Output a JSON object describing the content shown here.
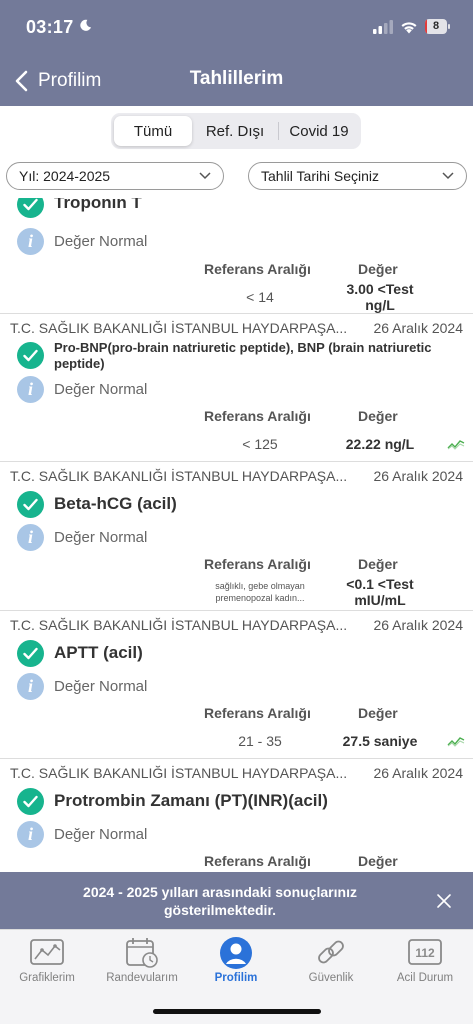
{
  "status_bar": {
    "time": "03:17",
    "battery_level": "8",
    "battery_fraction": 0.08
  },
  "nav": {
    "back_label": "Profilim",
    "title": "Tahlillerim"
  },
  "segments": [
    "Tümü",
    "Ref. Dışı",
    "Covid 19"
  ],
  "filters": {
    "year": "Yıl: 2024-2025",
    "date": "Tahlil Tarihi Seçiniz"
  },
  "results": {
    "ref_header": "Referans Aralığı",
    "value_header": "Değer",
    "status_label": "Değer Normal",
    "items": [
      {
        "hospital": "",
        "date": "",
        "name": "Troponin T",
        "reference": "< 14",
        "value": "3.00 <Test ng/L",
        "trend": false
      },
      {
        "hospital": "T.C. SAĞLIK BAKANLIĞI İSTANBUL HAYDARPAŞA...",
        "date": "26 Aralık 2024",
        "name": "Pro-BNP(pro-brain natriuretic peptide), BNP (brain natriuretic peptide)",
        "reference": "< 125",
        "value": "22.22 ng/L",
        "trend": true
      },
      {
        "hospital": "T.C. SAĞLIK BAKANLIĞI İSTANBUL HAYDARPAŞA...",
        "date": "26 Aralık 2024",
        "name": "Beta-hCG (acil)",
        "reference": "sağlıklı, gebe olmayan premenopozal kadın...",
        "value": "<0.1 <Test mIU/mL",
        "trend": false
      },
      {
        "hospital": "T.C. SAĞLIK BAKANLIĞI İSTANBUL HAYDARPAŞA...",
        "date": "26 Aralık 2024",
        "name": "APTT (acil)",
        "reference": "21 - 35",
        "value": "27.5 saniye",
        "trend": true
      },
      {
        "hospital": "T.C. SAĞLIK BAKANLIĞI İSTANBUL HAYDARPAŞA...",
        "date": "26 Aralık 2024",
        "name": "Protrombin Zamanı (PT)(INR)(acil)",
        "reference": "",
        "value": "",
        "trend": false
      }
    ]
  },
  "toast": {
    "message": "2024 - 2025 yılları arasındaki sonuçlarınız gösterilmektedir."
  },
  "tabbar": {
    "items": [
      {
        "label": "Grafiklerim",
        "icon": "chart-icon"
      },
      {
        "label": "Randevularım",
        "icon": "calendar-icon"
      },
      {
        "label": "Profilim",
        "icon": "profile-icon"
      },
      {
        "label": "Güvenlik",
        "icon": "link-icon"
      },
      {
        "label": "Acil Durum",
        "icon": "emergency-112-icon",
        "badge": "112"
      }
    ],
    "active": "Profilim"
  },
  "colors": {
    "header": "#737a99",
    "check": "#17b48e",
    "info": "#a9c6e6",
    "active_tab": "#2b72d9",
    "trend": "#4caf50"
  }
}
